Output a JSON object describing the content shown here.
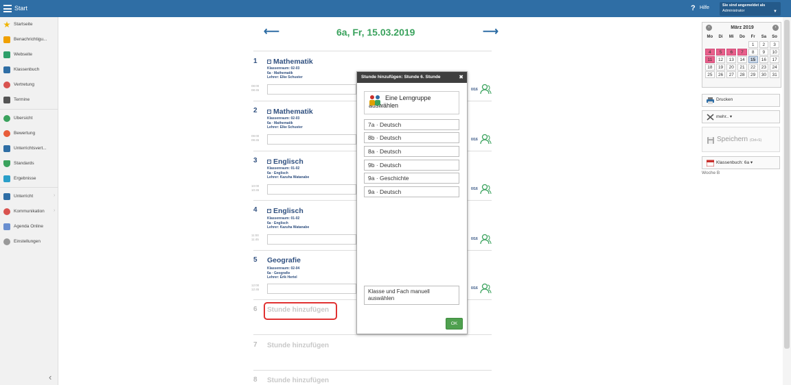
{
  "topbar": {
    "title": "Start",
    "help_label": "Hilfe",
    "user_line1": "Sie sind angemeldet als",
    "user_line2": "Administrator"
  },
  "sidebar": {
    "items": [
      {
        "label": "Startseite",
        "icon": "star-icon",
        "color": "#f0b400"
      },
      {
        "label": "Benachrichtigu...",
        "icon": "mail-icon",
        "color": "#f0a000"
      },
      {
        "label": "Webseite",
        "icon": "home-icon",
        "color": "#2e9f6a"
      },
      {
        "label": "Klassenbuch",
        "icon": "book-icon",
        "color": "#2f6ea5"
      },
      {
        "label": "Vertretung",
        "icon": "substitute-icon",
        "color": "#d9534f"
      },
      {
        "label": "Termine",
        "icon": "calendar-icon",
        "color": "#555"
      },
      {
        "label": "Übersicht",
        "icon": "check-icon",
        "color": "#3aa25d"
      },
      {
        "label": "Bewertung",
        "icon": "grade-icon",
        "color": "#e85d3a"
      },
      {
        "label": "Unterrichtsvert...",
        "icon": "grid-icon",
        "color": "#2f6ea5"
      },
      {
        "label": "Standards",
        "icon": "shield-icon",
        "color": "#3aa25d"
      },
      {
        "label": "Ergebnisse",
        "icon": "chart-icon",
        "color": "#2a9fc9"
      },
      {
        "label": "Unterricht",
        "icon": "briefcase-icon",
        "color": "#2f6ea5"
      },
      {
        "label": "Kommunikation",
        "icon": "chat-icon",
        "color": "#d9534f"
      },
      {
        "label": "Agenda Online",
        "icon": "pen-icon",
        "color": "#6a8fd0"
      },
      {
        "label": "Einstellungen",
        "icon": "gear-icon",
        "color": "#999"
      }
    ]
  },
  "main": {
    "day_title": "6a, Fr, 15.03.2019",
    "lessons": [
      {
        "num": "1",
        "subject": "Mathematik",
        "room_label": "Klassenraum:",
        "room": "02-03",
        "group": "6a · Mathematik",
        "teacher_label": "Lehrer:",
        "teacher": "Elke Schuster",
        "t1": "08:00",
        "t2": "08:45",
        "count": "0/16"
      },
      {
        "num": "2",
        "subject": "Mathematik",
        "room_label": "Klassenraum:",
        "room": "02-03",
        "group": "6a · Mathematik",
        "teacher_label": "Lehrer:",
        "teacher": "Elke Schuster",
        "t1": "09:00",
        "t2": "09:45",
        "count": "0/16"
      },
      {
        "num": "3",
        "subject": "Englisch",
        "room_label": "Klassenraum:",
        "room": "01-02",
        "group": "6a · Englisch",
        "teacher_label": "Lehrer:",
        "teacher": "Kazuha Watanabe",
        "t1": "10:00",
        "t2": "10:45",
        "count": "0/16"
      },
      {
        "num": "4",
        "subject": "Englisch",
        "room_label": "Klassenraum:",
        "room": "01-02",
        "group": "6a · Englisch",
        "teacher_label": "Lehrer:",
        "teacher": "Kazuha Watanabe",
        "t1": "11:00",
        "t2": "11:45",
        "count": "0/16"
      },
      {
        "num": "5",
        "subject": "Geografie",
        "room_label": "Klassenraum:",
        "room": "02-04",
        "group": "6a · Geografie",
        "teacher_label": "Lehrer:",
        "teacher": "Erik Hertel",
        "t1": "12:00",
        "t2": "12:45",
        "count": "0/16"
      }
    ],
    "empty_slots": [
      {
        "num": "6",
        "label": "Stunde hinzufügen"
      },
      {
        "num": "7",
        "label": "Stunde hinzufügen"
      },
      {
        "num": "8",
        "label": "Stunde hinzufügen"
      }
    ]
  },
  "modal": {
    "title": "Stunde hinzufügen: Stunde 6. Stunde",
    "close": "✖",
    "head_label": "Eine Lerngruppe auswählen",
    "groups": [
      "7a · Deutsch",
      "8b · Deutsch",
      "8a · Deutsch",
      "9b · Deutsch",
      "9a · Geschichte",
      "9a · Deutsch"
    ],
    "manual": "Klasse und Fach manuell auswählen",
    "ok": "OK"
  },
  "calendar": {
    "month": "März 2019",
    "weekdays": [
      "Mo",
      "Di",
      "Mi",
      "Do",
      "Fr",
      "Sa",
      "So"
    ],
    "weeks": [
      [
        "",
        "",
        "",
        "",
        "1",
        "2",
        "3"
      ],
      [
        "4",
        "5",
        "6",
        "7",
        "8",
        "9",
        "10"
      ],
      [
        "11",
        "12",
        "13",
        "14",
        "15",
        "16",
        "17"
      ],
      [
        "18",
        "19",
        "20",
        "21",
        "22",
        "23",
        "24"
      ],
      [
        "25",
        "26",
        "27",
        "28",
        "29",
        "30",
        "31"
      ]
    ],
    "highlight_color": "#e8608b"
  },
  "right": {
    "print": "Drucken",
    "more": "mehr.. ▾",
    "save": "Speichern",
    "save_hint": "(Ctrl+S)",
    "klassenbuch": "Klassenbuch: 6a ▾",
    "week": "Woche B"
  }
}
